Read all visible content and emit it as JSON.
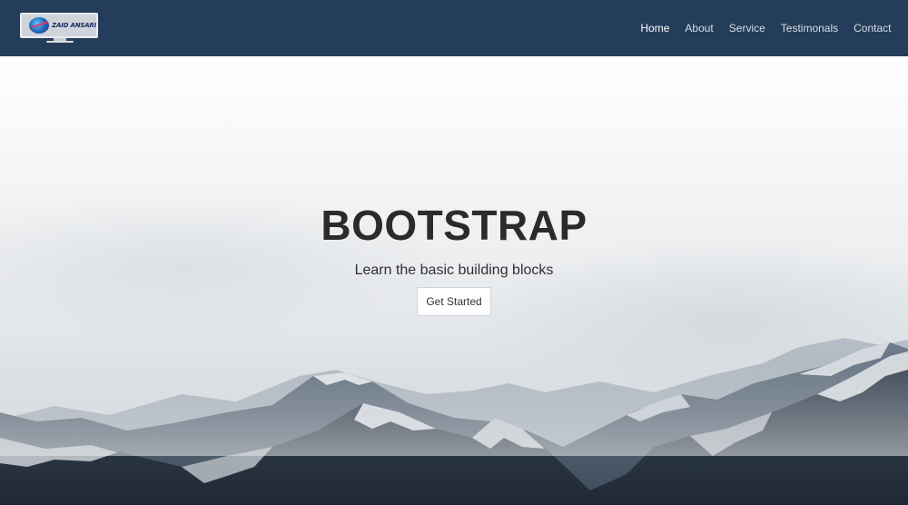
{
  "navbar": {
    "brand": {
      "logo_text": "ZAID ANSARI",
      "icon": "monitor-logo-icon"
    },
    "links": [
      {
        "label": "Home",
        "active": true
      },
      {
        "label": "About",
        "active": false
      },
      {
        "label": "Service",
        "active": false
      },
      {
        "label": "Testimonals",
        "active": false
      },
      {
        "label": "Contact",
        "active": false
      }
    ],
    "background": "#233d5a"
  },
  "hero": {
    "title": "BOOTSTRAP",
    "subtitle": "Learn the basic building blocks",
    "cta_label": "Get Started"
  }
}
